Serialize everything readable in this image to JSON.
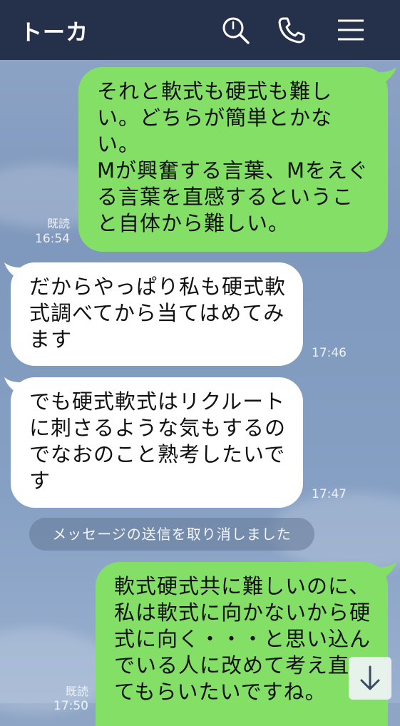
{
  "header": {
    "title": "トーカ"
  },
  "messages": [
    {
      "text": "それと軟式も硬式も難し\nい。どちらが簡単とかな\nい。\nMが興奮する言葉、Mをえぐ\nる言葉を直感するというこ\nと自体から難しい。",
      "read": "既読",
      "time": "16:54"
    },
    {
      "text": "だからやっぱり私も硬式軟\n式調べてから当てはめてみ\nます",
      "time": "17:46"
    },
    {
      "text": "でも硬式軟式はリクルート\nに刺さるような気もするの\nでなおのこと熟考したいで\nす",
      "time": "17:47"
    },
    {
      "text": "軟式硬式共に難しいのに、\n私は軟式に向かないから硬\n式に向く・・・と思い込ん\nでいる人に改めて考え直\nてもらいたいですね。",
      "read": "既読",
      "time": "17:50"
    }
  ],
  "system_notice": "メッセージの送信を取り消しました",
  "colors": {
    "header": "#25304a",
    "outgoing": "#84df67",
    "incoming": "#ffffff"
  }
}
